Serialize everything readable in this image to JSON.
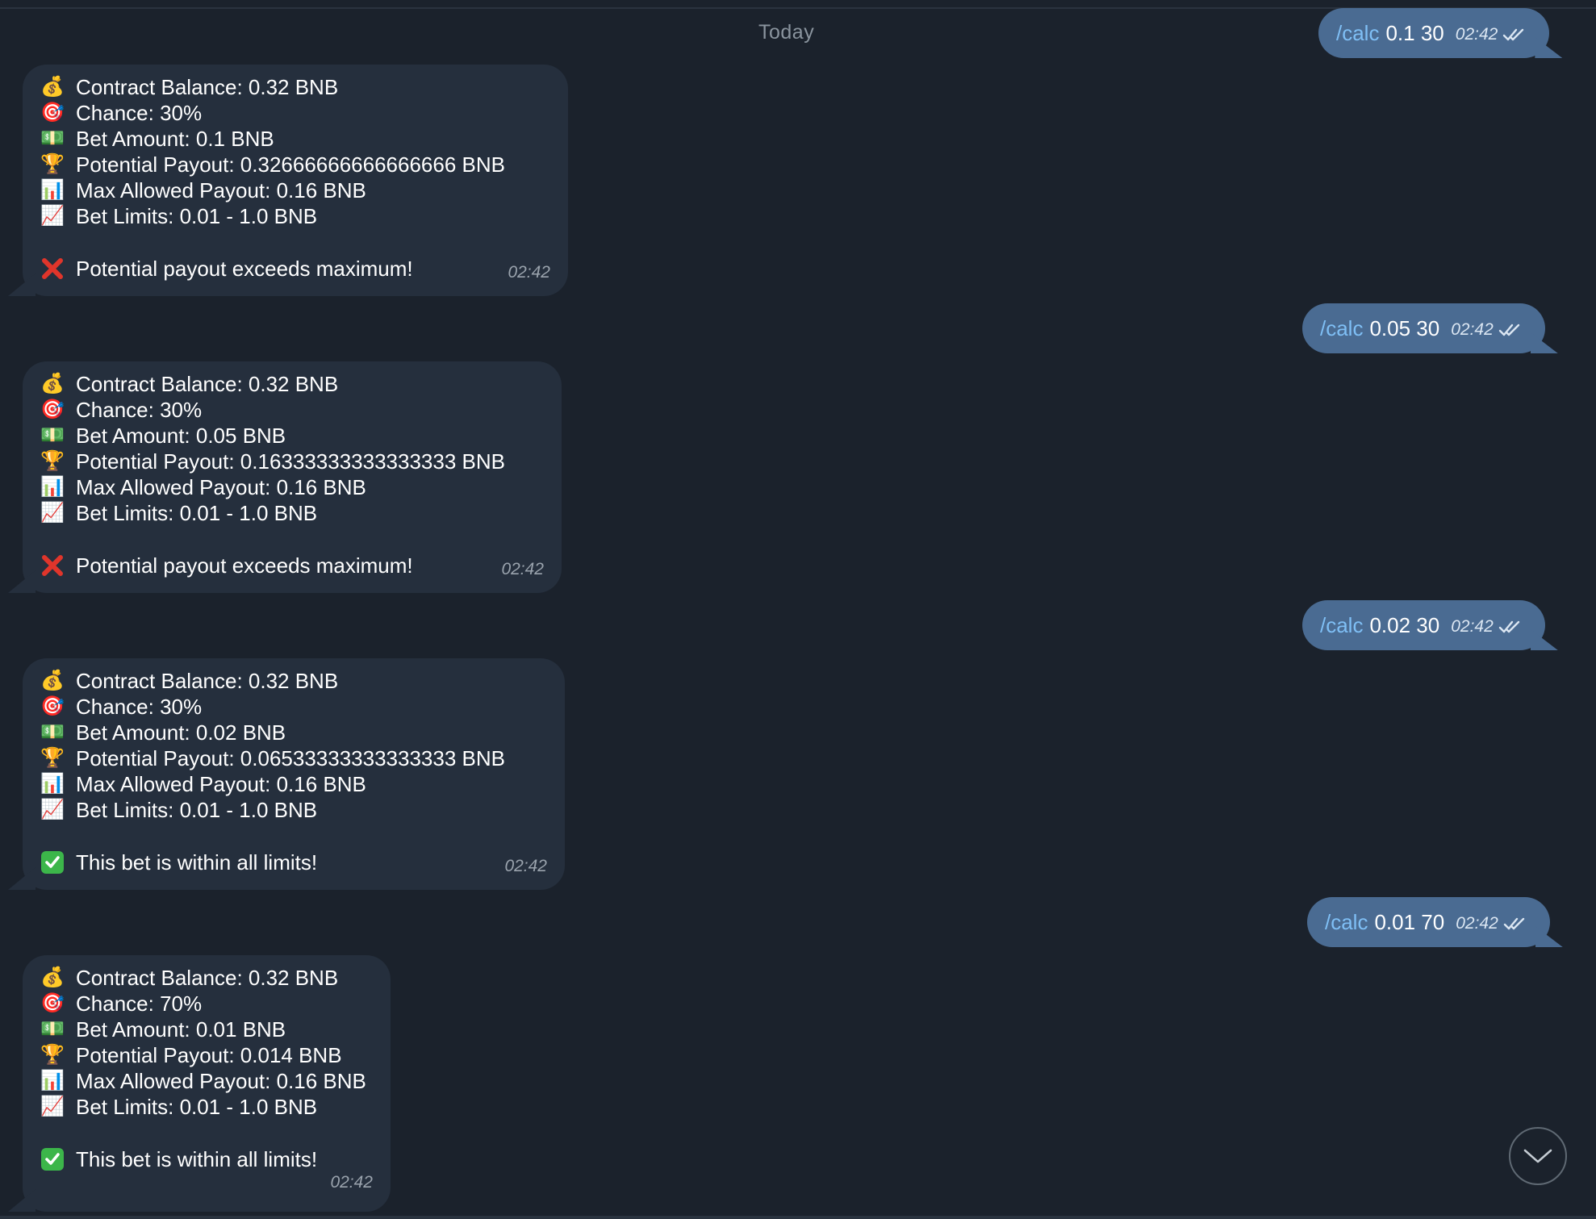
{
  "date_separator": "Today",
  "outgoing": [
    {
      "command": "/calc",
      "args": "0.1 30",
      "time": "02:42"
    },
    {
      "command": "/calc",
      "args": "0.05 30",
      "time": "02:42"
    },
    {
      "command": "/calc",
      "args": "0.02 30",
      "time": "02:42"
    },
    {
      "command": "/calc",
      "args": "0.01 70",
      "time": "02:42"
    }
  ],
  "incoming": [
    {
      "lines": [
        {
          "icon": "money-bag-icon",
          "text": "Contract Balance: 0.32 BNB"
        },
        {
          "icon": "target-icon",
          "text": "Chance: 30%"
        },
        {
          "icon": "dollar-banknote-icon",
          "text": "Bet Amount: 0.1 BNB"
        },
        {
          "icon": "trophy-icon",
          "text": "Potential Payout: 0.32666666666666666 BNB"
        },
        {
          "icon": "bar-chart-icon",
          "text": "Max Allowed Payout: 0.16 BNB"
        },
        {
          "icon": "chart-increasing-icon",
          "text": "Bet Limits: 0.01 - 1.0 BNB"
        }
      ],
      "status": {
        "icon": "cross-mark-icon",
        "text": "Potential payout exceeds maximum!"
      },
      "time": "02:42"
    },
    {
      "lines": [
        {
          "icon": "money-bag-icon",
          "text": "Contract Balance: 0.32 BNB"
        },
        {
          "icon": "target-icon",
          "text": "Chance: 30%"
        },
        {
          "icon": "dollar-banknote-icon",
          "text": "Bet Amount: 0.05 BNB"
        },
        {
          "icon": "trophy-icon",
          "text": "Potential Payout: 0.16333333333333333 BNB"
        },
        {
          "icon": "bar-chart-icon",
          "text": "Max Allowed Payout: 0.16 BNB"
        },
        {
          "icon": "chart-increasing-icon",
          "text": "Bet Limits: 0.01 - 1.0 BNB"
        }
      ],
      "status": {
        "icon": "cross-mark-icon",
        "text": "Potential payout exceeds maximum!"
      },
      "time": "02:42"
    },
    {
      "lines": [
        {
          "icon": "money-bag-icon",
          "text": "Contract Balance: 0.32 BNB"
        },
        {
          "icon": "target-icon",
          "text": "Chance: 30%"
        },
        {
          "icon": "dollar-banknote-icon",
          "text": "Bet Amount: 0.02 BNB"
        },
        {
          "icon": "trophy-icon",
          "text": "Potential Payout: 0.06533333333333333 BNB"
        },
        {
          "icon": "bar-chart-icon",
          "text": "Max Allowed Payout: 0.16 BNB"
        },
        {
          "icon": "chart-increasing-icon",
          "text": "Bet Limits: 0.01 - 1.0 BNB"
        }
      ],
      "status": {
        "icon": "check-mark-button-icon",
        "text": "This bet is within all limits!"
      },
      "time": "02:42"
    },
    {
      "lines": [
        {
          "icon": "money-bag-icon",
          "text": "Contract Balance: 0.32 BNB"
        },
        {
          "icon": "target-icon",
          "text": "Chance: 70%"
        },
        {
          "icon": "dollar-banknote-icon",
          "text": "Bet Amount: 0.01 BNB"
        },
        {
          "icon": "trophy-icon",
          "text": "Potential Payout: 0.014 BNB"
        },
        {
          "icon": "bar-chart-icon",
          "text": "Max Allowed Payout: 0.16 BNB"
        },
        {
          "icon": "chart-increasing-icon",
          "text": "Bet Limits: 0.01 - 1.0 BNB"
        }
      ],
      "status": {
        "icon": "check-mark-button-icon",
        "text": "This bet is within all limits!"
      },
      "time": "02:42"
    }
  ],
  "colors": {
    "background": "#1b222c",
    "incoming_bubble": "#252f3d",
    "outgoing_bubble": "#4a6b92",
    "command_link": "#7fbff5",
    "cross_mark": "#e0352b",
    "check_mark": "#3cb64a"
  },
  "scroll_button_icon": "chevron-down-icon"
}
